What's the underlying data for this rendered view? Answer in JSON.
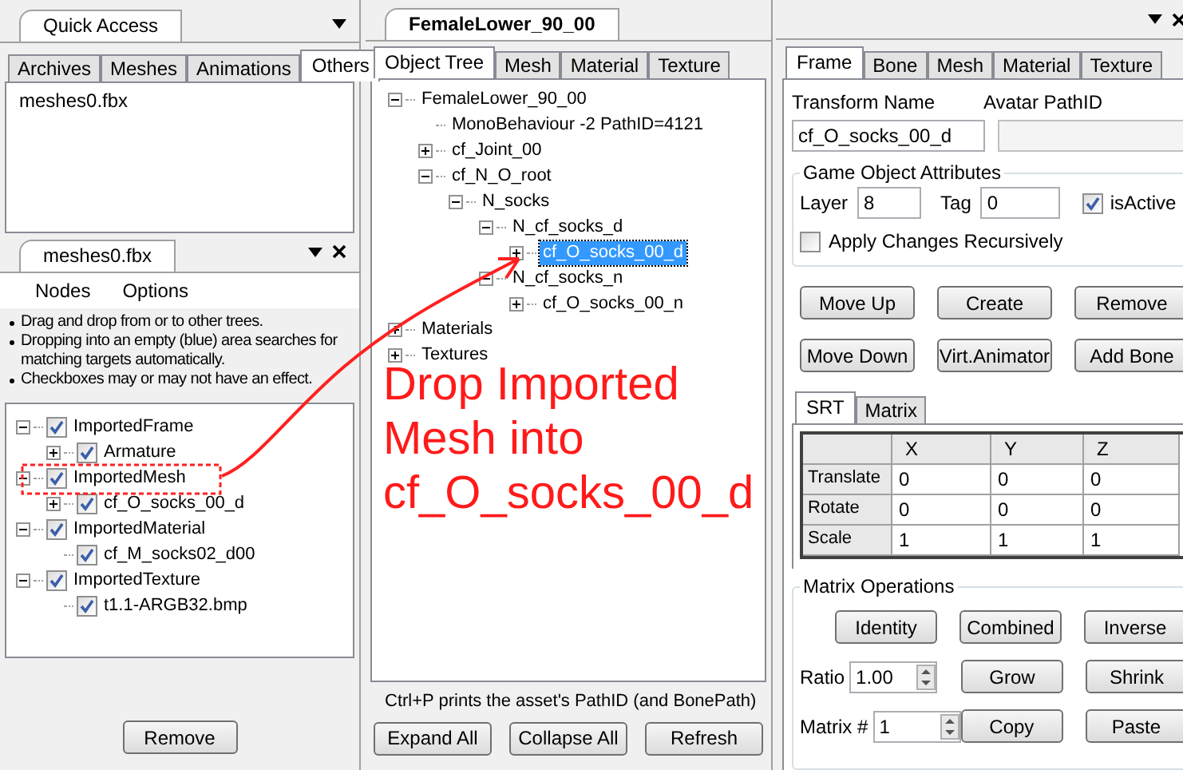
{
  "quick_access": {
    "title": "Quick Access",
    "tabs": [
      {
        "label": "Archives",
        "selected": false
      },
      {
        "label": "Meshes",
        "selected": false
      },
      {
        "label": "Animations",
        "selected": false
      },
      {
        "label": "Others",
        "selected": true
      }
    ],
    "items": [
      "meshes0.fbx"
    ]
  },
  "import_panel": {
    "title": "meshes0.fbx",
    "menu": [
      "Nodes",
      "Options"
    ],
    "hints": [
      "Drag and drop from or to other trees.",
      "Dropping into an empty (blue) area searches for matching targets automatically.",
      "Checkboxes may or may not have an effect."
    ],
    "tree": [
      {
        "label": "ImportedFrame",
        "checked": true,
        "expanded": true,
        "children": [
          {
            "label": "Armature",
            "checked": true,
            "expanded": false
          }
        ]
      },
      {
        "label": "ImportedMesh",
        "checked": true,
        "expanded": true,
        "children": [
          {
            "label": "cf_O_socks_00_d",
            "checked": true,
            "expanded": false
          }
        ]
      },
      {
        "label": "ImportedMaterial",
        "checked": true,
        "expanded": true,
        "children": [
          {
            "label": "cf_M_socks02_d00",
            "checked": true
          }
        ]
      },
      {
        "label": "ImportedTexture",
        "checked": true,
        "expanded": true,
        "children": [
          {
            "label": "t1.1-ARGB32.bmp",
            "checked": true
          }
        ]
      }
    ],
    "button": "Remove"
  },
  "object_panel": {
    "title": "FemaleLower_90_00",
    "tabs": [
      {
        "label": "Object Tree",
        "selected": true
      },
      {
        "label": "Mesh",
        "selected": false
      },
      {
        "label": "Material",
        "selected": false
      },
      {
        "label": "Texture",
        "selected": false
      }
    ],
    "tree": [
      {
        "label": "FemaleLower_90_00",
        "selected": false,
        "expanded": true,
        "children": [
          {
            "label": "MonoBehaviour -2 PathID=4121",
            "selected": false
          },
          {
            "label": "cf_Joint_00",
            "selected": false,
            "expanded": false
          },
          {
            "label": "cf_N_O_root",
            "selected": false,
            "expanded": true,
            "children": [
              {
                "label": "N_socks",
                "selected": false,
                "expanded": true,
                "children": [
                  {
                    "label": "N_cf_socks_d",
                    "selected": false,
                    "expanded": true,
                    "children": [
                      {
                        "label": "cf_O_socks_00_d",
                        "selected": true,
                        "expanded": false
                      }
                    ]
                  },
                  {
                    "label": "N_cf_socks_n",
                    "selected": false,
                    "expanded": true,
                    "children": [
                      {
                        "label": "cf_O_socks_00_n",
                        "selected": false,
                        "expanded": false
                      }
                    ]
                  }
                ]
              }
            ]
          }
        ]
      },
      {
        "label": "Materials",
        "selected": false,
        "expanded": false
      },
      {
        "label": "Textures",
        "selected": false,
        "expanded": false
      }
    ],
    "hint": "Ctrl+P prints the asset's PathID (and BonePath)",
    "buttons": [
      "Expand All",
      "Collapse All",
      "Refresh"
    ]
  },
  "frame_panel": {
    "tabs": [
      {
        "label": "Frame",
        "selected": true
      },
      {
        "label": "Bone",
        "selected": false
      },
      {
        "label": "Mesh",
        "selected": false
      },
      {
        "label": "Material",
        "selected": false
      },
      {
        "label": "Texture",
        "selected": false
      }
    ],
    "transform_name_label": "Transform Name",
    "transform_name": "cf_O_socks_00_d",
    "avatar_label": "Avatar PathID",
    "attributes": {
      "title": "Game Object Attributes",
      "layer_label": "Layer",
      "layer": "8",
      "tag_label": "Tag",
      "tag": "0",
      "is_active": {
        "label": "isActive",
        "checked": true
      },
      "apply_recursively": {
        "label": "Apply Changes Recursively",
        "checked": false
      }
    },
    "buttons": [
      "Move Up",
      "Create",
      "Remove",
      "Move Down",
      "Virt.Animator",
      "Add Bone"
    ],
    "srt_tabs": [
      {
        "label": "SRT",
        "selected": true
      },
      {
        "label": "Matrix",
        "selected": false
      }
    ],
    "table": {
      "columns": [
        "X",
        "Y",
        "Z"
      ],
      "rows": [
        {
          "label": "Translate",
          "values": [
            "0",
            "0",
            "0"
          ]
        },
        {
          "label": "Rotate",
          "values": [
            "0",
            "0",
            "0"
          ]
        },
        {
          "label": "Scale",
          "values": [
            "1",
            "1",
            "1"
          ]
        }
      ]
    },
    "matrix_operations": {
      "title": "Matrix Operations",
      "buttons": [
        "Identity",
        "Combined",
        "Inverse"
      ],
      "ratio_label": "Ratio",
      "ratio": "1.00",
      "ratio_buttons": [
        "Grow",
        "Shrink"
      ],
      "matrix_label": "Matrix #",
      "matrix": "1",
      "matrix_buttons": [
        "Copy",
        "Paste"
      ]
    }
  },
  "annotation": {
    "lines": [
      "Drop Imported",
      "Mesh into",
      "cf_O_socks_00_d"
    ]
  }
}
